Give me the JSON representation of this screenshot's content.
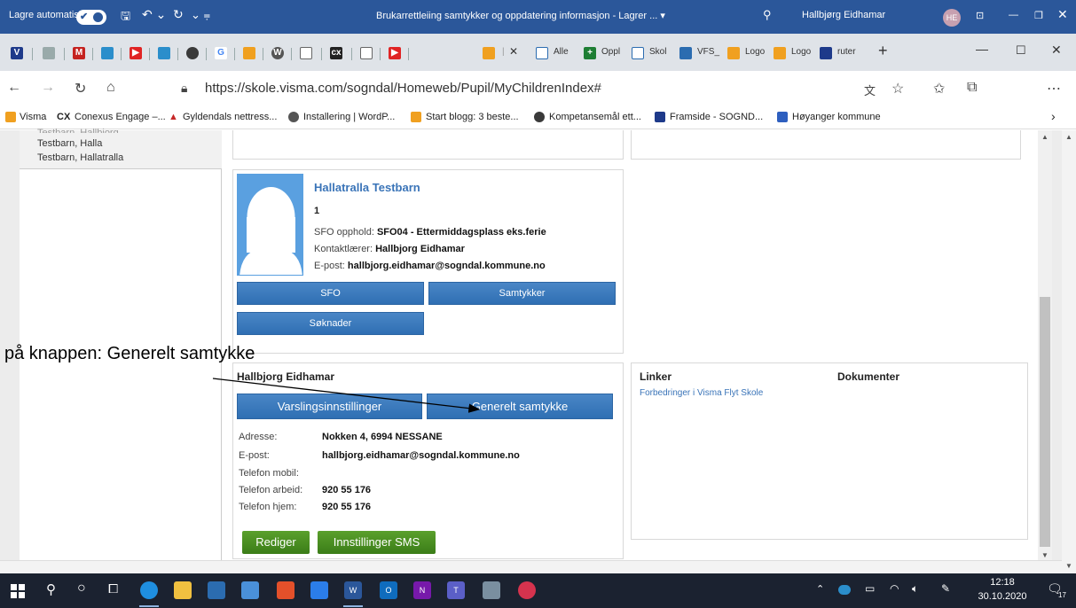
{
  "word": {
    "autosave_label": "Lagre automatisk",
    "doc_title": "Brukarrettleiing samtykker og oppdatering informasjon - Lagrer ... ▾",
    "user_name": "Hallbjørg Eidhamar",
    "user_initials": "HE"
  },
  "browser": {
    "tabs": [
      {
        "label": "Alle"
      },
      {
        "label": "Oppl"
      },
      {
        "label": "Skol"
      },
      {
        "label": "VFS_"
      },
      {
        "label": "Logo"
      },
      {
        "label": "Logo"
      },
      {
        "label": "ruter"
      }
    ],
    "url": "https://skole.visma.com/sogndal/Homeweb/Pupil/MyChildrenIndex#",
    "bookmarks": [
      {
        "label": "Visma"
      },
      {
        "label": "Conexus Engage –..."
      },
      {
        "label": "Gyldendals nettress..."
      },
      {
        "label": "Installering | WordP..."
      },
      {
        "label": "Start blogg: 3 beste..."
      },
      {
        "label": "Kompetansemål ett..."
      },
      {
        "label": "Framside - SOGND..."
      },
      {
        "label": "Høyanger kommune"
      }
    ]
  },
  "sidebar": {
    "children": [
      "Testbarn, Halla",
      "Testbarn, Hallatralla"
    ]
  },
  "child_card": {
    "name": "Hallatralla Testbarn",
    "grade": "1",
    "sfo_label": "SFO opphold:",
    "sfo_value": "SFO04 - Ettermiddagsplass eks.ferie",
    "teacher_label": "Kontaktlærer:",
    "teacher_value": "Hallbjorg Eidhamar",
    "email_label": "E-post:",
    "email_value": "hallbjorg.eidhamar@sogndal.kommune.no",
    "btn_sfo": "SFO",
    "btn_samtykker": "Samtykker",
    "btn_soknader": "Søknader"
  },
  "parent_card": {
    "name": "Hallbjorg Eidhamar",
    "btn_varsling": "Varslingsinnstillinger",
    "btn_generelt": "Generelt samtykke",
    "fields": [
      {
        "label": "Adresse:",
        "value": "Nokken 4, 6994 NESSANE"
      },
      {
        "label": "E-post:",
        "value": "hallbjorg.eidhamar@sogndal.kommune.no"
      },
      {
        "label": "Telefon mobil:",
        "value": ""
      },
      {
        "label": "Telefon arbeid:",
        "value": "920 55 176"
      },
      {
        "label": "Telefon hjem:",
        "value": "920 55 176"
      }
    ],
    "btn_rediger": "Rediger",
    "btn_sms": "Innstillinger SMS"
  },
  "links_card": {
    "links_heading": "Linker",
    "docs_heading": "Dokumenter",
    "link1": "Forbedringer i Visma Flyt Skole"
  },
  "annotation": "på knappen: Generelt samtykke",
  "taskbar": {
    "time": "12:18",
    "date": "30.10.2020",
    "notif_count": "17"
  }
}
